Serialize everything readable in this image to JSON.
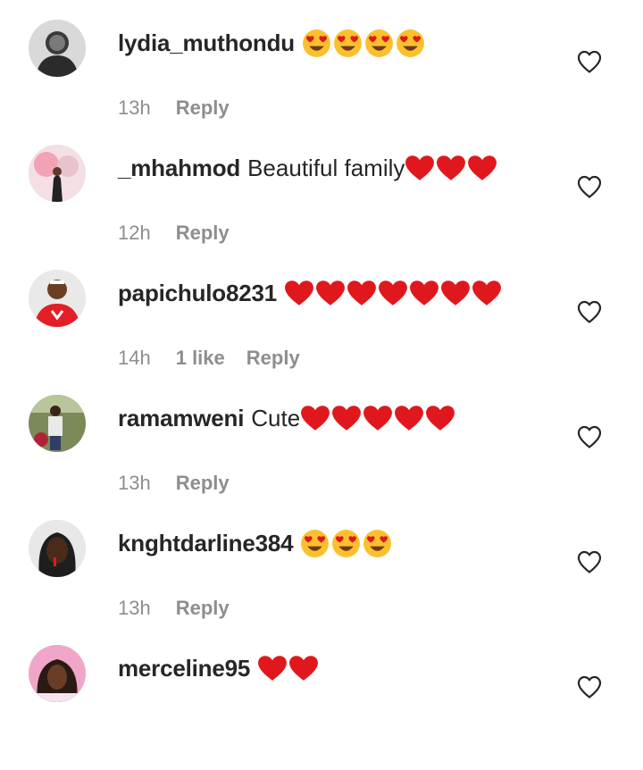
{
  "comments": [
    {
      "username": "lydia_muthondu",
      "text": "",
      "emojis": [
        "heart-eyes",
        "heart-eyes",
        "heart-eyes",
        "heart-eyes"
      ],
      "time": "13h",
      "likes": "",
      "reply": "Reply"
    },
    {
      "username": "_mhahmod",
      "text": "Beautiful family",
      "emojis": [
        "red-heart",
        "red-heart",
        "red-heart"
      ],
      "time": "12h",
      "likes": "",
      "reply": "Reply"
    },
    {
      "username": "papichulo8231",
      "text": "",
      "emojis": [
        "red-heart",
        "red-heart",
        "red-heart",
        "red-heart",
        "red-heart",
        "red-heart",
        "red-heart"
      ],
      "time": "14h",
      "likes": "1 like",
      "reply": "Reply"
    },
    {
      "username": "ramamweni",
      "text": "Cute",
      "emojis": [
        "red-heart",
        "red-heart",
        "red-heart",
        "red-heart",
        "red-heart"
      ],
      "time": "13h",
      "likes": "",
      "reply": "Reply"
    },
    {
      "username": "knghtdarline384",
      "text": "",
      "emojis": [
        "heart-eyes",
        "heart-eyes",
        "heart-eyes"
      ],
      "time": "13h",
      "likes": "",
      "reply": "Reply"
    },
    {
      "username": "merceline95",
      "text": "",
      "emojis": [
        "red-heart",
        "red-heart"
      ],
      "time": "",
      "likes": "",
      "reply": ""
    }
  ],
  "colors": {
    "text": "#262626",
    "meta": "#8e8e8e",
    "heart": "#e0181d",
    "emoji_face": "#fbc02d"
  },
  "icons": {
    "like": "heart-outline-icon",
    "avatar": "profile-photo"
  }
}
